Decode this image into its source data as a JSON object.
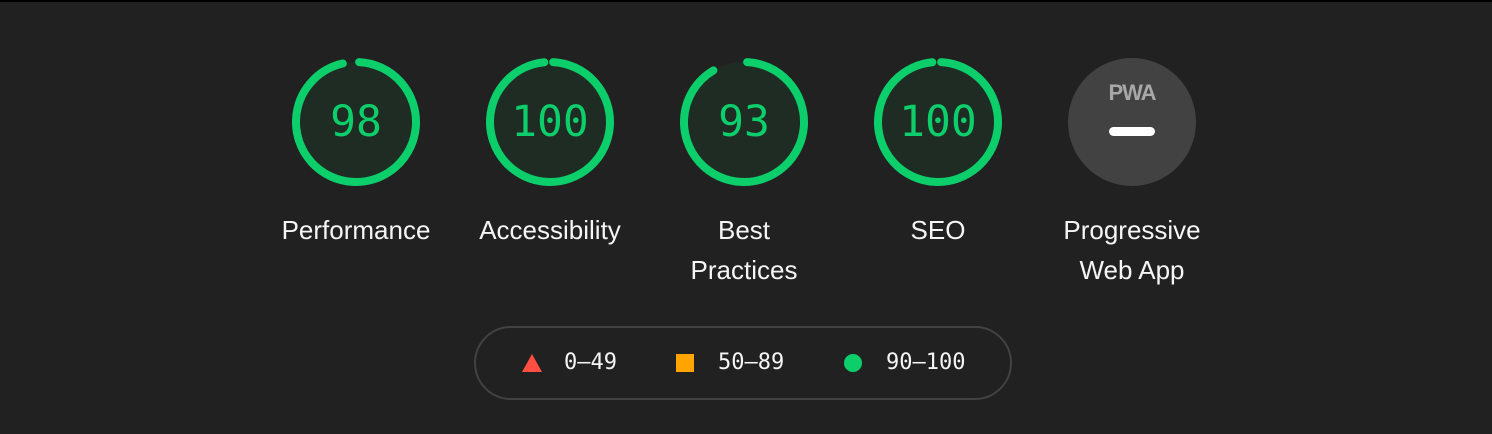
{
  "categories": [
    {
      "id": "performance",
      "score": "98",
      "score_fraction": 0.98,
      "label": "Performance",
      "status": "pass"
    },
    {
      "id": "accessibility",
      "score": "100",
      "score_fraction": 1.0,
      "label": "Accessibility",
      "status": "pass"
    },
    {
      "id": "best-practices",
      "score": "93",
      "score_fraction": 0.93,
      "label": "Best\nPractices",
      "status": "pass"
    },
    {
      "id": "seo",
      "score": "100",
      "score_fraction": 1.0,
      "label": "SEO",
      "status": "pass"
    },
    {
      "id": "pwa",
      "logo_text": "PWA",
      "label": "Progressive\nWeb App",
      "icon": "pwa-not-applicable-dash-icon"
    }
  ],
  "legend": [
    {
      "range": "0–49",
      "icon": "triangle-fail-icon",
      "color": "#ff4e42"
    },
    {
      "range": "50–89",
      "icon": "square-average-icon",
      "color": "#ffa400"
    },
    {
      "range": "90–100",
      "icon": "circle-pass-icon",
      "color": "#0cce6b"
    }
  ],
  "colors": {
    "background": "#212121",
    "pass": "#0cce6b",
    "pass_fill": "#1f2c24",
    "text": "#f5f5f5",
    "pwa_badge": "#424242",
    "legend_border": "#424242"
  }
}
